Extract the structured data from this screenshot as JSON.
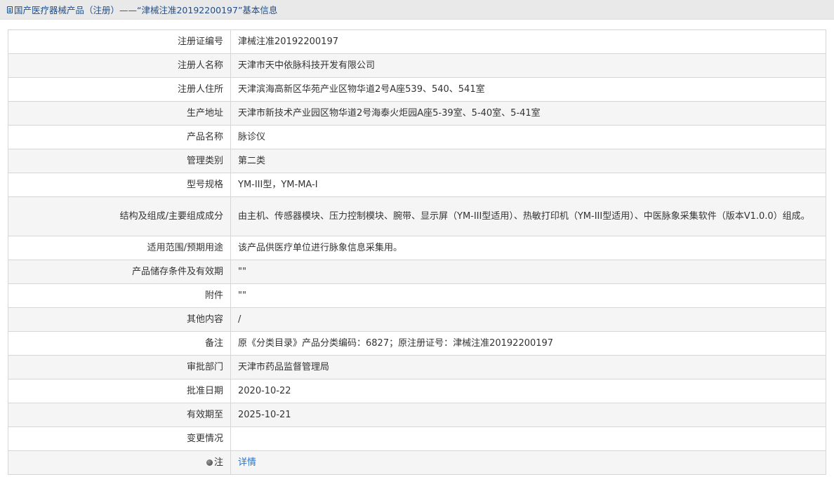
{
  "breadcrumb": {
    "icon": "document-icon",
    "text": "国产医疗器械产品（注册）——“津械注准20192200197”基本信息"
  },
  "rows": [
    {
      "label": "注册证编号",
      "value": "津械注准20192200197"
    },
    {
      "label": "注册人名称",
      "value": "天津市天中依脉科技开发有限公司"
    },
    {
      "label": "注册人住所",
      "value": "天津滨海高新区华苑产业区物华道2号A座539、540、541室"
    },
    {
      "label": "生产地址",
      "value": "天津市新技术产业园区物华道2号海泰火炬园A座5-39室、5-40室、5-41室"
    },
    {
      "label": "产品名称",
      "value": "脉诊仪"
    },
    {
      "label": "管理类别",
      "value": "第二类"
    },
    {
      "label": "型号规格",
      "value": "YM-III型，YM-MA-I"
    },
    {
      "label": "结构及组成/主要组成成分",
      "value": "由主机、传感器模块、压力控制模块、腕带、显示屏（YM-III型适用）、热敏打印机（YM-III型适用）、中医脉象采集软件（版本V1.0.0）组成。"
    },
    {
      "label": "适用范围/预期用途",
      "value": "该产品供医疗单位进行脉象信息采集用。"
    },
    {
      "label": "产品储存条件及有效期",
      "value": "\"\""
    },
    {
      "label": "附件",
      "value": "\"\""
    },
    {
      "label": "其他内容",
      "value": "/"
    },
    {
      "label": "备注",
      "value": "原《分类目录》产品分类编码：6827；原注册证号：津械注准20192200197"
    },
    {
      "label": "审批部门",
      "value": "天津市药品监督管理局"
    },
    {
      "label": "批准日期",
      "value": "2020-10-22"
    },
    {
      "label": "有效期至",
      "value": "2025-10-21"
    },
    {
      "label": "变更情况",
      "value": ""
    }
  ],
  "note_row": {
    "icon": "pin-icon",
    "label": "注",
    "link_text": "详情"
  },
  "colors": {
    "link": "#2a74c7",
    "breadcrumb_text": "#1f4f8a",
    "alt_row_bg": "#f5f5f5",
    "border": "#d6d6d6"
  }
}
